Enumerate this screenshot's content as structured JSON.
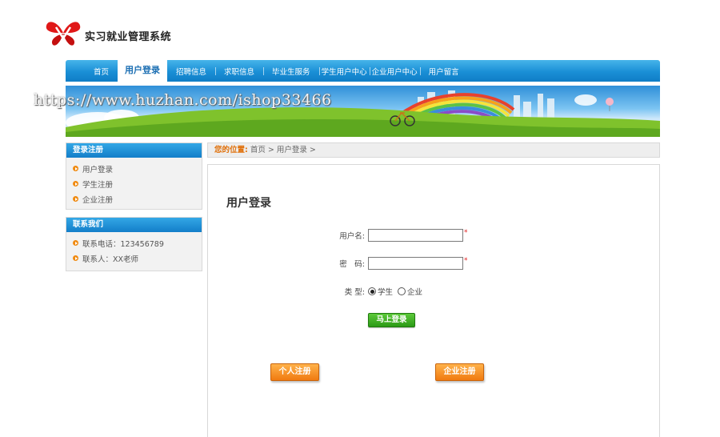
{
  "header": {
    "site_title": "实习就业管理系统",
    "logo_icon": "butterfly-logo-icon"
  },
  "nav": {
    "items": [
      {
        "label": "首页"
      },
      {
        "label": "用户登录",
        "active": true
      },
      {
        "label": "招聘信息"
      },
      {
        "label": "求职信息"
      },
      {
        "label": "毕业生服务"
      },
      {
        "label": "学生用户中心"
      },
      {
        "label": "企业用户中心"
      },
      {
        "label": "用户留言"
      }
    ]
  },
  "banner": {
    "watermark": "https://www.huzhan.com/ishop33466"
  },
  "sidebar": {
    "register": {
      "title": "登录注册",
      "items": [
        "用户登录",
        "学生注册",
        "企业注册"
      ]
    },
    "contact": {
      "title": "联系我们",
      "items": [
        "联系电话：123456789",
        "联系人：XX老师"
      ]
    }
  },
  "breadcrumb": {
    "label": "您的位置:",
    "path": "首页 > 用户登录 >"
  },
  "login": {
    "title": "用户登录",
    "username_label": "用户名:",
    "username_value": "",
    "password_label": "密　码:",
    "password_value": "",
    "required_mark": "*",
    "type_label": "类 型:",
    "type_options": [
      {
        "label": "学生",
        "selected": true
      },
      {
        "label": "企业",
        "selected": false
      }
    ],
    "submit_label": "马上登录",
    "student_register_label": "个人注册",
    "company_register_label": "企业注册"
  },
  "colors": {
    "nav_blue": "#1a8fd6",
    "accent_orange": "#f07a10",
    "button_green": "#2b9a16",
    "required_red": "#e02020"
  }
}
